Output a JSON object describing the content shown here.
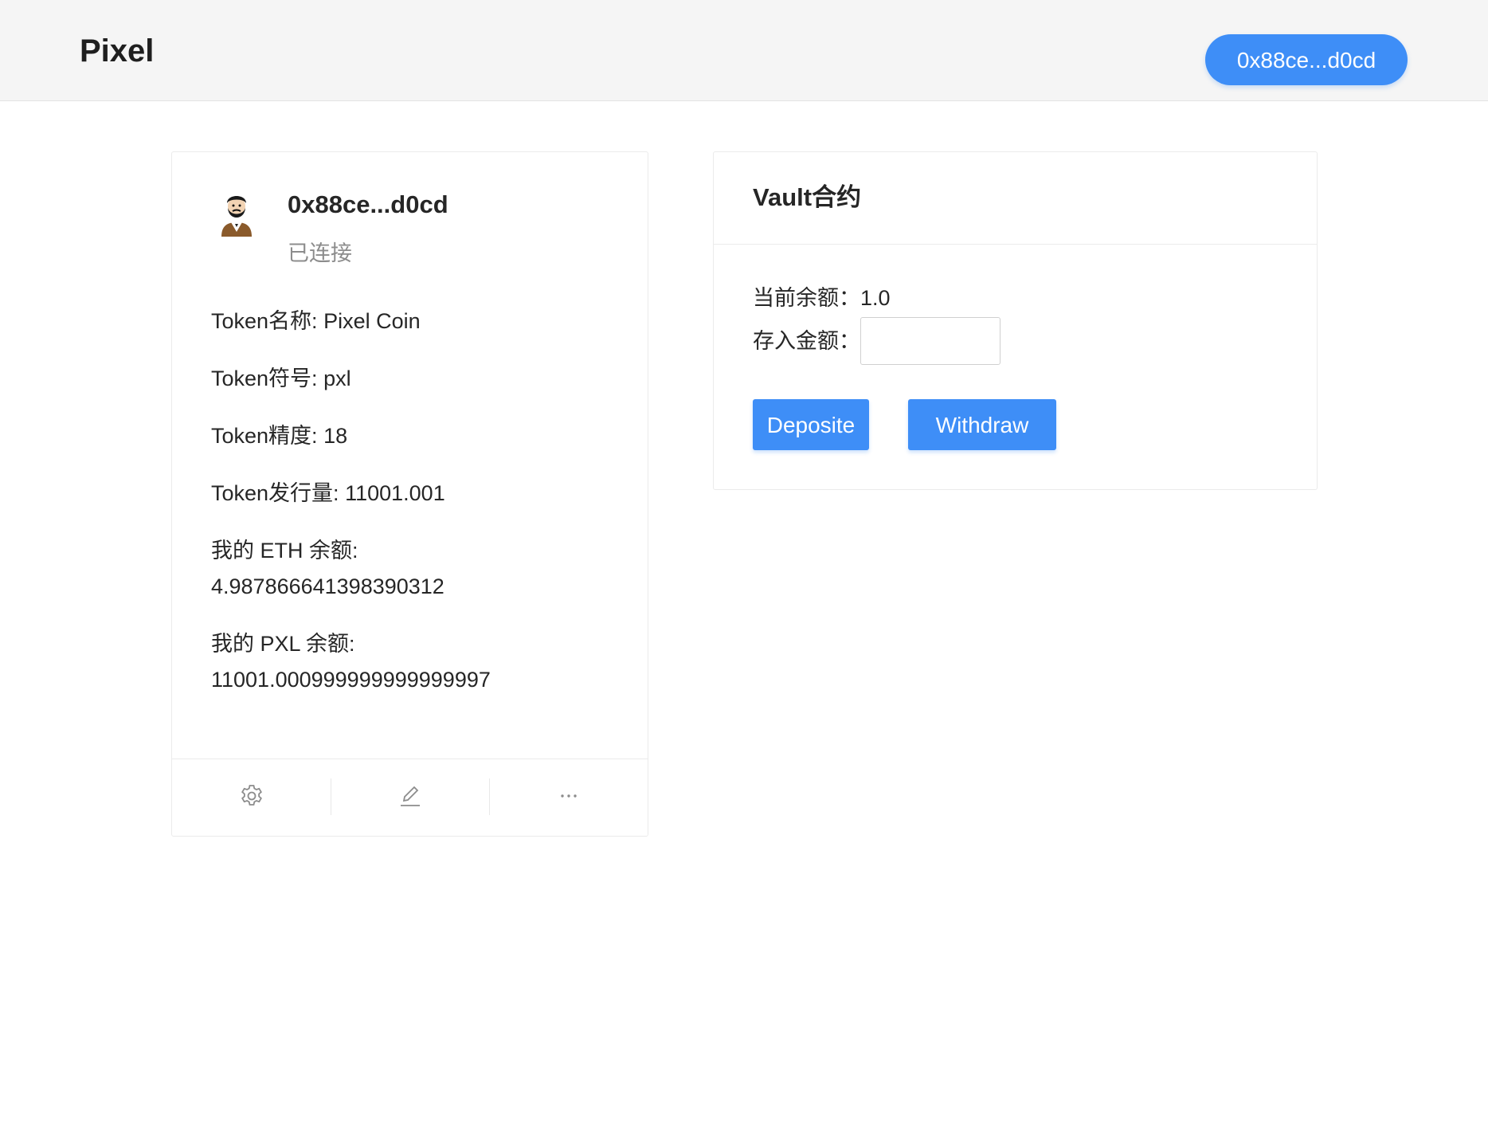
{
  "header": {
    "brand": "Pixel",
    "wallet_button": "0x88ce...d0cd"
  },
  "profile": {
    "avatar_icon": "bearded-man-avatar-icon",
    "address": "0x88ce...d0cd",
    "status": "已连接",
    "info": [
      {
        "label": "Token名称:",
        "value": "Pixel Coin"
      },
      {
        "label": "Token符号:",
        "value": "pxl"
      },
      {
        "label": "Token精度:",
        "value": "18"
      },
      {
        "label": "Token发行量:",
        "value": "11001.001"
      },
      {
        "label": "我的 ETH 余额:",
        "value": "4.987866641398390312"
      },
      {
        "label": "我的 PXL 余额:",
        "value": "11001.000999999999999997"
      }
    ],
    "actions": [
      "settings-icon",
      "edit-icon",
      "ellipsis-icon"
    ]
  },
  "vault": {
    "title": "Vault合约",
    "balance_label": "当前余额：",
    "balance_value": "1.0",
    "amount_label": "存入金额：",
    "amount_value": "",
    "amount_placeholder": "",
    "deposit_label": "Deposite",
    "withdraw_label": "Withdraw"
  },
  "colors": {
    "accent": "#3e8ef7",
    "header_bg": "#f5f5f5",
    "muted_text": "#8c8c8c"
  }
}
